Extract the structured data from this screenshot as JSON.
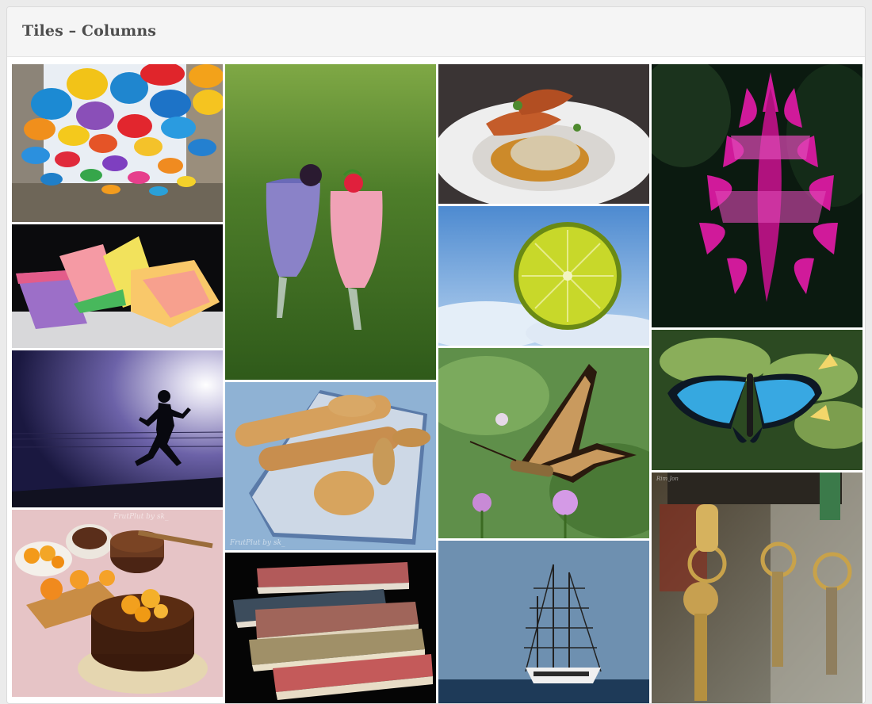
{
  "panel": {
    "title": "Tiles – Columns"
  },
  "tiles": [
    {
      "subject": "umbrellas"
    },
    {
      "subject": "jelly candies"
    },
    {
      "subject": "runner silhouette"
    },
    {
      "subject": "chocolate orange cake",
      "caption": "FrutPlut by sk_"
    },
    {
      "subject": "smoothie glasses"
    },
    {
      "subject": "bread basket",
      "caption": "FrutPlut by sk_"
    },
    {
      "subject": "stack of books"
    },
    {
      "subject": "shrimp dish"
    },
    {
      "subject": "lime slice"
    },
    {
      "subject": "swallowtail butterfly"
    },
    {
      "subject": "tall ship"
    },
    {
      "subject": "pink flower"
    },
    {
      "subject": "blue morpho butterfly"
    },
    {
      "subject": "hanging keys",
      "caption": "Rim Jon"
    }
  ]
}
